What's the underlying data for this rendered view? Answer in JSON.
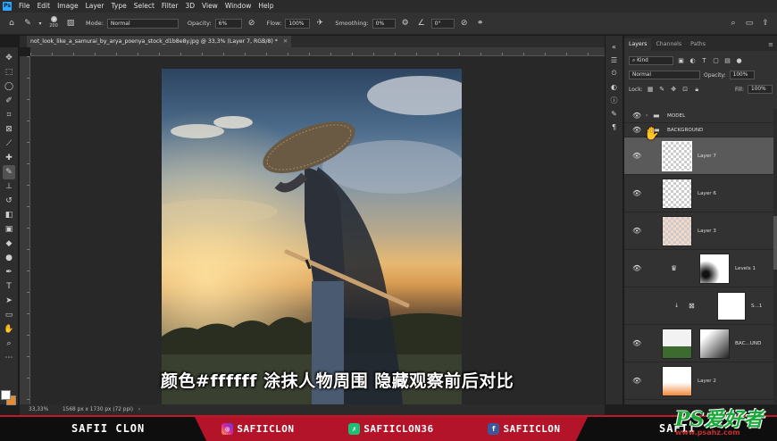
{
  "menubar": {
    "items": [
      "File",
      "Edit",
      "Image",
      "Layer",
      "Type",
      "Select",
      "Filter",
      "3D",
      "View",
      "Window",
      "Help"
    ]
  },
  "options": {
    "brush_size": "200",
    "mode_label": "Mode:",
    "mode_value": "Normal",
    "opacity_label": "Opacity:",
    "opacity_value": "6%",
    "flow_label": "Flow:",
    "flow_value": "100%",
    "smoothing_label": "Smoothing:",
    "smoothing_value": "0%",
    "angle_value": "0°"
  },
  "document": {
    "tab_title": "not_look_like_a_samurai_by_arya_poenya_stock_d1b8e8y.jpg @ 33,3% (Layer 7, RGB/8) *",
    "zoom": "33,33%",
    "doc_info": "1568 px x 1730 px (72 ppi)"
  },
  "subtitle": "颜色#ffffff 涂抹人物周围 隐藏观察前后对比",
  "panel": {
    "tabs": [
      "Layers",
      "Channels",
      "Paths"
    ],
    "kind_label": "Kind",
    "blend_mode": "Normal",
    "opacity_label": "Opacity:",
    "opacity_value": "100%",
    "lock_label": "Lock:",
    "fill_label": "Fill:",
    "fill_value": "100%",
    "layers": [
      {
        "name": "MODEL",
        "type": "group"
      },
      {
        "name": "BACKGROUND",
        "type": "group"
      },
      {
        "name": "Layer 7",
        "type": "pixel",
        "selected": true
      },
      {
        "name": "Layer 6",
        "type": "pixel"
      },
      {
        "name": "Layer 3",
        "type": "pixel"
      },
      {
        "name": "Levels 1",
        "type": "adjustment"
      },
      {
        "name": "S...1",
        "type": "adjustment"
      },
      {
        "name": "BAC...UND",
        "type": "pixel"
      },
      {
        "name": "Layer 2",
        "type": "pixel"
      }
    ]
  },
  "banner": {
    "left_name": "SAFII CLON",
    "instagram": "SAFIICLON",
    "fiverr": "SAFIICLON36",
    "facebook": "SAFIICLON",
    "right_name": "SAFII"
  },
  "watermark": {
    "main": "PS爱好者",
    "sub": "www.psahz.com"
  },
  "colors": {
    "foreground": "#ffffff",
    "background": "#e88a2e",
    "accent": "#31a8ff",
    "banner_red": "#b3142a"
  }
}
